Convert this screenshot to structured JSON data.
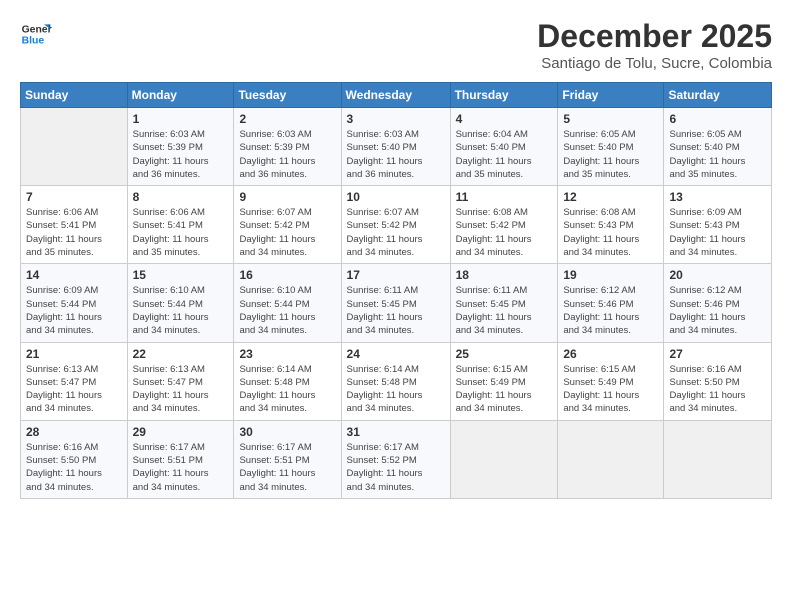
{
  "logo": {
    "line1": "General",
    "line2": "Blue"
  },
  "header": {
    "month": "December 2025",
    "location": "Santiago de Tolu, Sucre, Colombia"
  },
  "weekdays": [
    "Sunday",
    "Monday",
    "Tuesday",
    "Wednesday",
    "Thursday",
    "Friday",
    "Saturday"
  ],
  "weeks": [
    [
      {
        "day": "",
        "info": ""
      },
      {
        "day": "1",
        "info": "Sunrise: 6:03 AM\nSunset: 5:39 PM\nDaylight: 11 hours\nand 36 minutes."
      },
      {
        "day": "2",
        "info": "Sunrise: 6:03 AM\nSunset: 5:39 PM\nDaylight: 11 hours\nand 36 minutes."
      },
      {
        "day": "3",
        "info": "Sunrise: 6:03 AM\nSunset: 5:40 PM\nDaylight: 11 hours\nand 36 minutes."
      },
      {
        "day": "4",
        "info": "Sunrise: 6:04 AM\nSunset: 5:40 PM\nDaylight: 11 hours\nand 35 minutes."
      },
      {
        "day": "5",
        "info": "Sunrise: 6:05 AM\nSunset: 5:40 PM\nDaylight: 11 hours\nand 35 minutes."
      },
      {
        "day": "6",
        "info": "Sunrise: 6:05 AM\nSunset: 5:40 PM\nDaylight: 11 hours\nand 35 minutes."
      }
    ],
    [
      {
        "day": "7",
        "info": "Sunrise: 6:06 AM\nSunset: 5:41 PM\nDaylight: 11 hours\nand 35 minutes."
      },
      {
        "day": "8",
        "info": "Sunrise: 6:06 AM\nSunset: 5:41 PM\nDaylight: 11 hours\nand 35 minutes."
      },
      {
        "day": "9",
        "info": "Sunrise: 6:07 AM\nSunset: 5:42 PM\nDaylight: 11 hours\nand 34 minutes."
      },
      {
        "day": "10",
        "info": "Sunrise: 6:07 AM\nSunset: 5:42 PM\nDaylight: 11 hours\nand 34 minutes."
      },
      {
        "day": "11",
        "info": "Sunrise: 6:08 AM\nSunset: 5:42 PM\nDaylight: 11 hours\nand 34 minutes."
      },
      {
        "day": "12",
        "info": "Sunrise: 6:08 AM\nSunset: 5:43 PM\nDaylight: 11 hours\nand 34 minutes."
      },
      {
        "day": "13",
        "info": "Sunrise: 6:09 AM\nSunset: 5:43 PM\nDaylight: 11 hours\nand 34 minutes."
      }
    ],
    [
      {
        "day": "14",
        "info": "Sunrise: 6:09 AM\nSunset: 5:44 PM\nDaylight: 11 hours\nand 34 minutes."
      },
      {
        "day": "15",
        "info": "Sunrise: 6:10 AM\nSunset: 5:44 PM\nDaylight: 11 hours\nand 34 minutes."
      },
      {
        "day": "16",
        "info": "Sunrise: 6:10 AM\nSunset: 5:44 PM\nDaylight: 11 hours\nand 34 minutes."
      },
      {
        "day": "17",
        "info": "Sunrise: 6:11 AM\nSunset: 5:45 PM\nDaylight: 11 hours\nand 34 minutes."
      },
      {
        "day": "18",
        "info": "Sunrise: 6:11 AM\nSunset: 5:45 PM\nDaylight: 11 hours\nand 34 minutes."
      },
      {
        "day": "19",
        "info": "Sunrise: 6:12 AM\nSunset: 5:46 PM\nDaylight: 11 hours\nand 34 minutes."
      },
      {
        "day": "20",
        "info": "Sunrise: 6:12 AM\nSunset: 5:46 PM\nDaylight: 11 hours\nand 34 minutes."
      }
    ],
    [
      {
        "day": "21",
        "info": "Sunrise: 6:13 AM\nSunset: 5:47 PM\nDaylight: 11 hours\nand 34 minutes."
      },
      {
        "day": "22",
        "info": "Sunrise: 6:13 AM\nSunset: 5:47 PM\nDaylight: 11 hours\nand 34 minutes."
      },
      {
        "day": "23",
        "info": "Sunrise: 6:14 AM\nSunset: 5:48 PM\nDaylight: 11 hours\nand 34 minutes."
      },
      {
        "day": "24",
        "info": "Sunrise: 6:14 AM\nSunset: 5:48 PM\nDaylight: 11 hours\nand 34 minutes."
      },
      {
        "day": "25",
        "info": "Sunrise: 6:15 AM\nSunset: 5:49 PM\nDaylight: 11 hours\nand 34 minutes."
      },
      {
        "day": "26",
        "info": "Sunrise: 6:15 AM\nSunset: 5:49 PM\nDaylight: 11 hours\nand 34 minutes."
      },
      {
        "day": "27",
        "info": "Sunrise: 6:16 AM\nSunset: 5:50 PM\nDaylight: 11 hours\nand 34 minutes."
      }
    ],
    [
      {
        "day": "28",
        "info": "Sunrise: 6:16 AM\nSunset: 5:50 PM\nDaylight: 11 hours\nand 34 minutes."
      },
      {
        "day": "29",
        "info": "Sunrise: 6:17 AM\nSunset: 5:51 PM\nDaylight: 11 hours\nand 34 minutes."
      },
      {
        "day": "30",
        "info": "Sunrise: 6:17 AM\nSunset: 5:51 PM\nDaylight: 11 hours\nand 34 minutes."
      },
      {
        "day": "31",
        "info": "Sunrise: 6:17 AM\nSunset: 5:52 PM\nDaylight: 11 hours\nand 34 minutes."
      },
      {
        "day": "",
        "info": ""
      },
      {
        "day": "",
        "info": ""
      },
      {
        "day": "",
        "info": ""
      }
    ]
  ]
}
